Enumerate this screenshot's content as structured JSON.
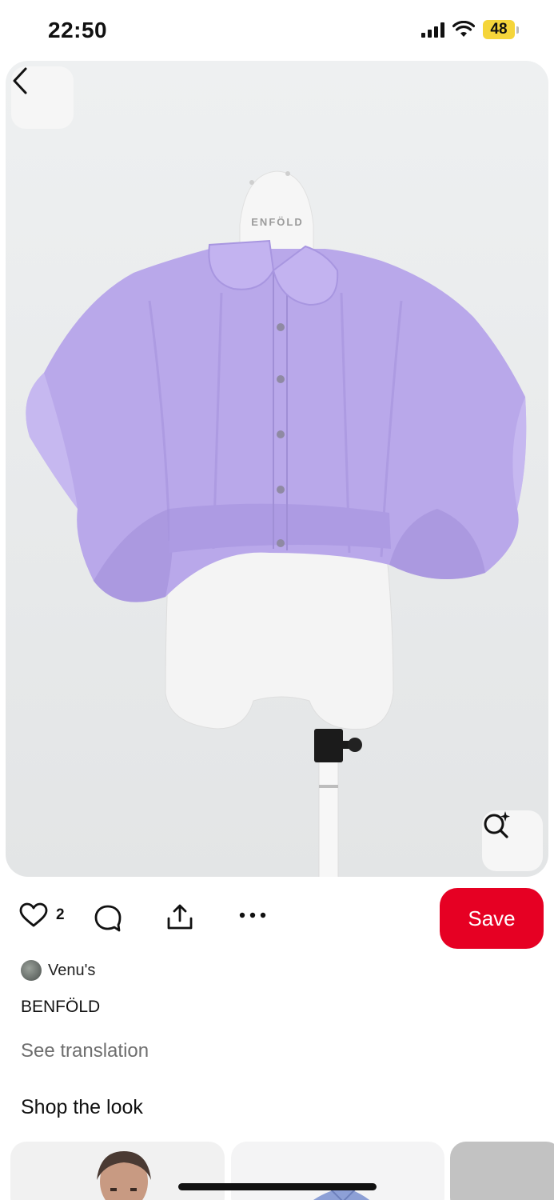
{
  "status_bar": {
    "time": "22:50",
    "battery_level": "48"
  },
  "hero": {
    "image_alt": "BENFÖLD",
    "mannequin_label": "ENFÖLD",
    "back_icon": "chevron-left-icon",
    "lens_icon": "visual-search-icon"
  },
  "actions": {
    "like_count": "2",
    "save_label": "Save"
  },
  "pin": {
    "author": "Venu's",
    "title": "BENFÖLD",
    "see_translation": "See translation"
  },
  "shop": {
    "heading": "Shop the look"
  },
  "colors": {
    "save_red": "#e60023",
    "shirt_lavender": "#b7a6e9",
    "battery_yellow": "#f5d53a"
  }
}
